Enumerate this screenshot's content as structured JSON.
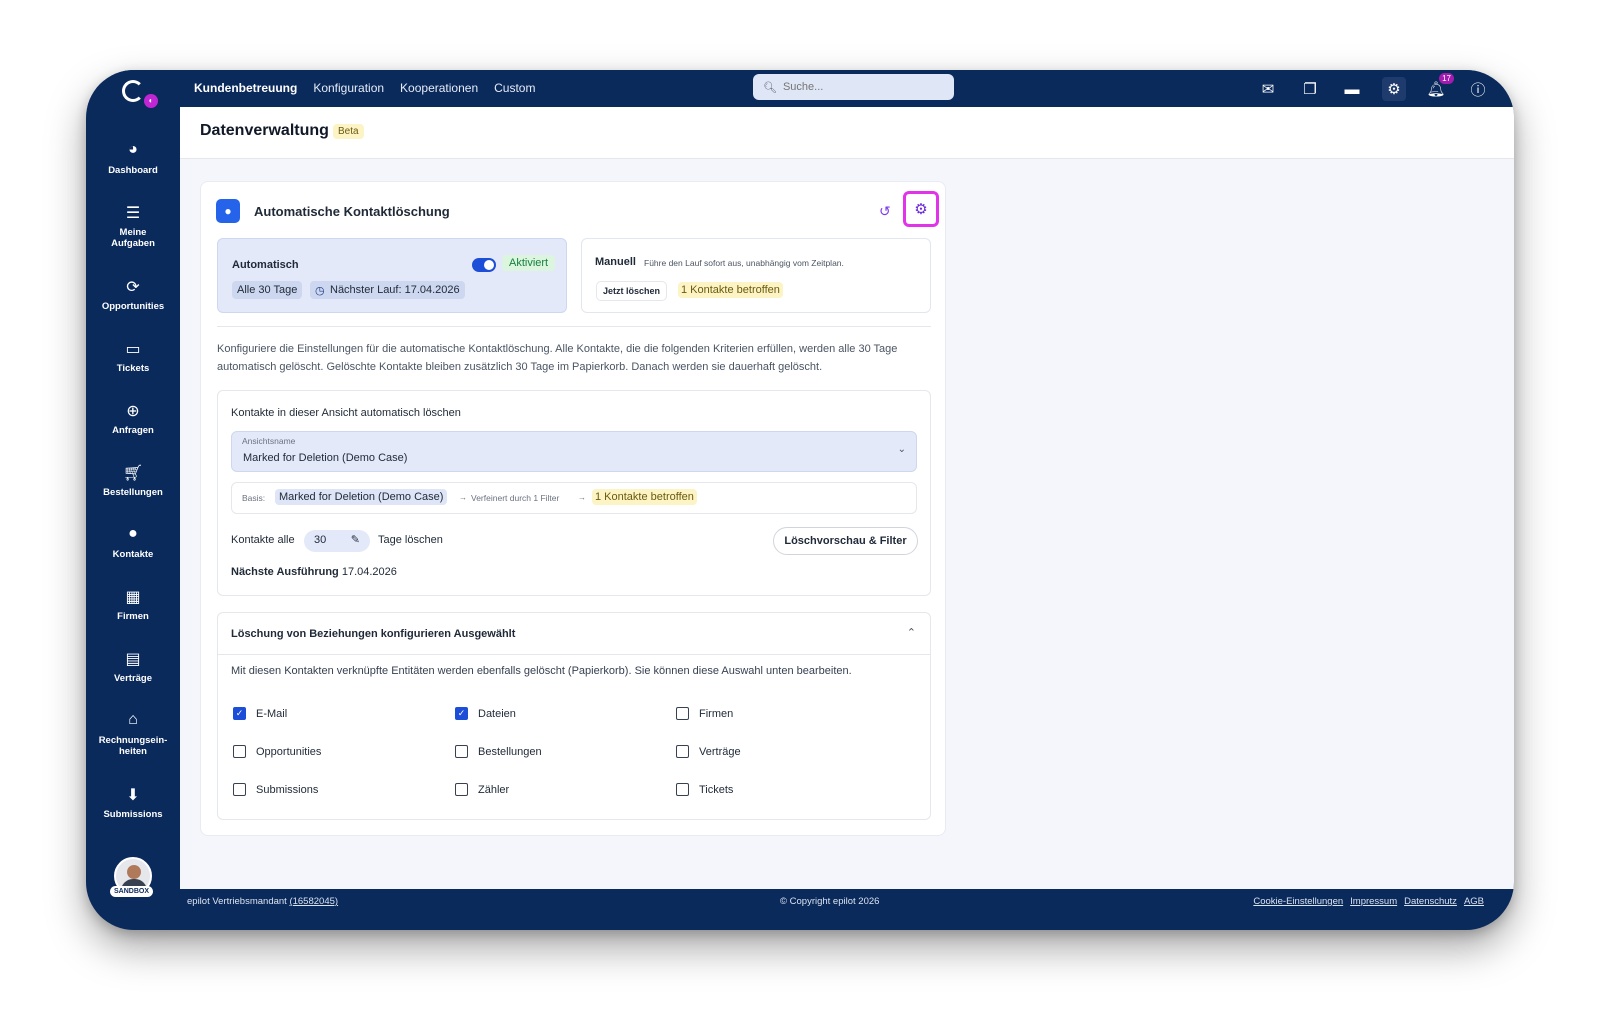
{
  "topnav": {
    "items": [
      "Kundenbetreuung",
      "Konfiguration",
      "Kooperationen",
      "Custom"
    ],
    "search_placeholder": "Suche...",
    "notification_count": "17"
  },
  "sidebar": {
    "items": [
      {
        "label": "Dashboard",
        "icon": "dashboard-icon"
      },
      {
        "label": "Meine Aufgaben",
        "icon": "tasks-icon"
      },
      {
        "label": "Opportunities",
        "icon": "opportunities-icon"
      },
      {
        "label": "Tickets",
        "icon": "ticket-icon"
      },
      {
        "label": "Anfragen",
        "icon": "lifebuoy-icon"
      },
      {
        "label": "Bestellungen",
        "icon": "cart-icon"
      },
      {
        "label": "Kontakte",
        "icon": "person-icon"
      },
      {
        "label": "Firmen",
        "icon": "building-icon"
      },
      {
        "label": "Verträge",
        "icon": "clipboard-icon"
      },
      {
        "label": "Rechnungsein-heiten",
        "icon": "bank-icon"
      },
      {
        "label": "Submissions",
        "icon": "inbox-icon"
      }
    ],
    "sandbox_label": "SANDBOX"
  },
  "page": {
    "title": "Datenverwaltung",
    "badge": "Beta"
  },
  "card": {
    "title": "Automatische Kontaktlöschung",
    "automatic": {
      "label": "Automatisch",
      "status": "Aktiviert",
      "interval": "Alle 30 Tage",
      "next_run": "Nächster Lauf: 17.04.2026"
    },
    "manual": {
      "label": "Manuell",
      "description": "Führe den Lauf sofort aus, unabhängig vom Zeitplan.",
      "button": "Jetzt löschen",
      "affected": "1 Kontakte betroffen"
    },
    "description": "Konfiguriere die Einstellungen für die automatische Kontaktlöschung. Alle Kontakte, die die folgenden Kriterien erfüllen, werden alle 30 Tage automatisch gelöscht. Gelöschte Kontakte bleiben zusätzlich 30 Tage im Papierkorb. Danach werden sie dauerhaft gelöscht.",
    "view": {
      "label": "Kontakte in dieser Ansicht automatisch löschen",
      "select_label": "Ansichtsname",
      "select_value": "Marked for Deletion (Demo Case)",
      "basis_label": "Basis:",
      "basis_chip": "Marked for Deletion (Demo Case)",
      "refined": "Verfeinert durch 1 Filter",
      "affected": "1 Kontakte betroffen",
      "contacts_every": "Kontakte alle",
      "days_value": "30",
      "days_suffix": "Tage löschen",
      "preview_button": "Löschvorschau & Filter",
      "next_exec_label": "Nächste Ausführung",
      "next_exec_date": "17.04.2026"
    },
    "relations": {
      "title": "Löschung von Beziehungen konfigurieren Ausgewählt",
      "description": "Mit diesen Kontakten verknüpfte Entitäten werden ebenfalls gelöscht (Papierkorb). Sie können diese Auswahl unten bearbeiten.",
      "options": [
        {
          "label": "E-Mail",
          "checked": true
        },
        {
          "label": "Dateien",
          "checked": true
        },
        {
          "label": "Firmen",
          "checked": false
        },
        {
          "label": "Opportunities",
          "checked": false
        },
        {
          "label": "Bestellungen",
          "checked": false
        },
        {
          "label": "Verträge",
          "checked": false
        },
        {
          "label": "Submissions",
          "checked": false
        },
        {
          "label": "Zähler",
          "checked": false
        },
        {
          "label": "Tickets",
          "checked": false
        }
      ]
    }
  },
  "footer": {
    "tenant": "epilot Vertriebsmandant",
    "tenant_id": "(16582045)",
    "copyright": "© Copyright epilot 2026",
    "links": [
      "Cookie-Einstellungen",
      "Impressum",
      "Datenschutz",
      "AGB"
    ]
  },
  "colors": {
    "navy": "#0b2a5c",
    "accent_blue": "#1d4ed8",
    "highlight_magenta": "#e134e8"
  }
}
